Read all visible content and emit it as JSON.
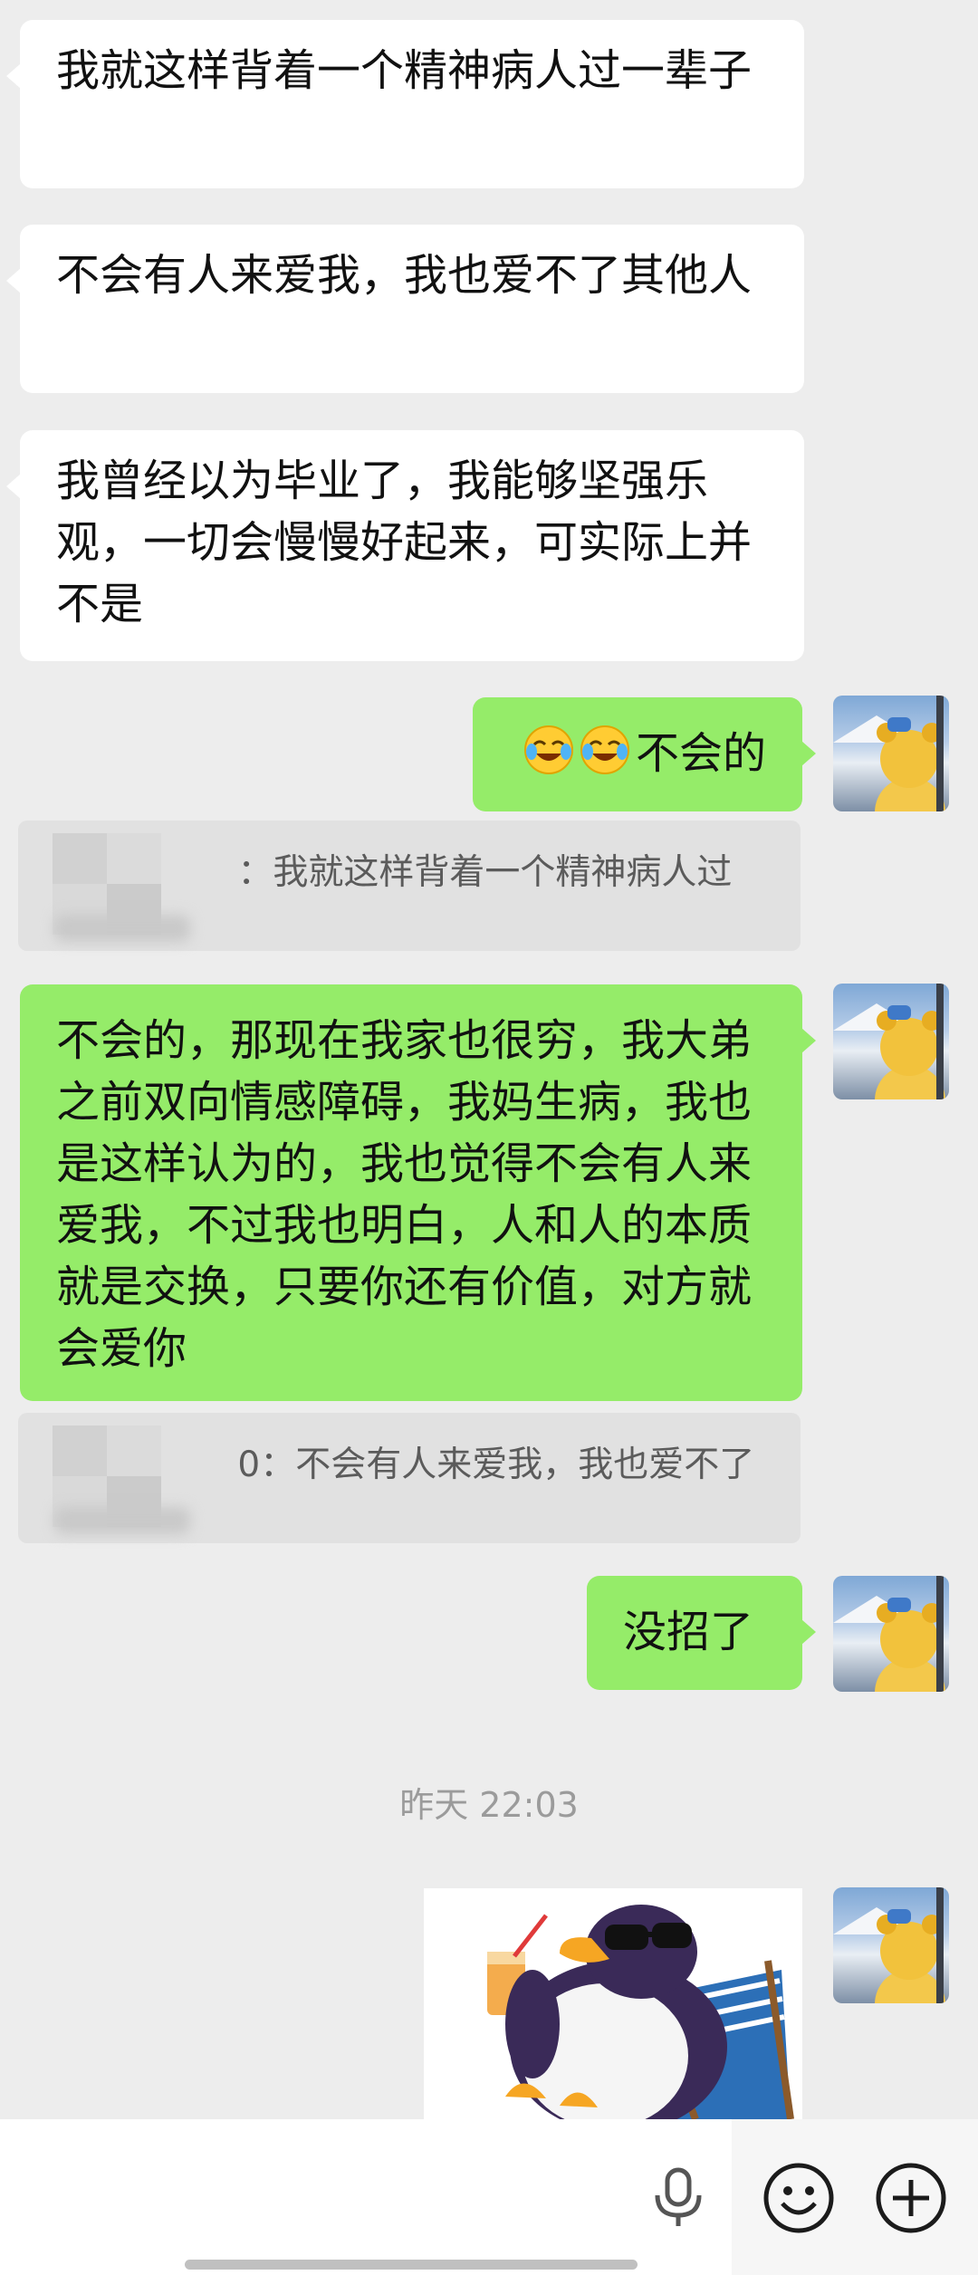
{
  "messages": [
    {
      "side": "left",
      "text": "我就这样背着一个精神病人过一辈子"
    },
    {
      "side": "left",
      "text": "不会有人来爱我，我也爱不了其他人"
    },
    {
      "side": "left",
      "text": "我曾经以为毕业了，我能够坚强乐观，一切会慢慢好起来，可实际上并不是"
    },
    {
      "side": "right",
      "emoji": [
        "crying-laughing",
        "crying-laughing"
      ],
      "text": "不会的"
    },
    {
      "side": "right",
      "text": "不会的，那现在我家也很穷，我大弟之前双向情感障碍，我妈生病，我也是这样认为的，我也觉得不会有人来爱我，不过我也明白，人和人的本质就是交换，只要你还有价值，对方就会爱你"
    },
    {
      "side": "right",
      "text": "没招了"
    }
  ],
  "quotes": [
    {
      "text": "：我就这样背着一个精神病人过"
    },
    {
      "text": "0：不会有人来爱我，我也爱不了"
    }
  ],
  "timestamp": "昨天 22:03",
  "sticker": {
    "icon": "penguin-sticker"
  },
  "input_bar": {
    "voice_icon": "microphone-icon",
    "emoji_icon": "smiley-icon",
    "more_icon": "plus-icon"
  },
  "colors": {
    "background": "#ededed",
    "incoming": "#ffffff",
    "outgoing": "#95ec69"
  }
}
